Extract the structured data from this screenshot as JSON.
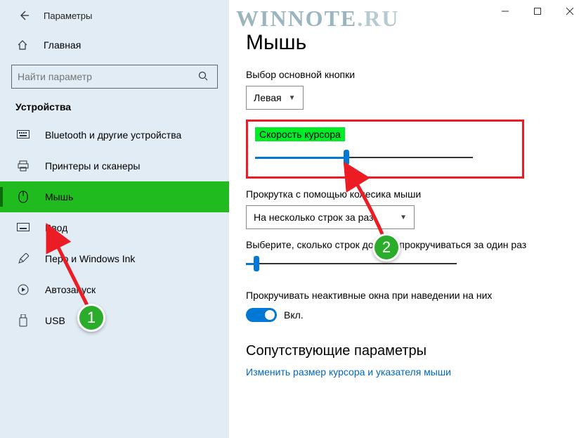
{
  "window": {
    "title": "Параметры"
  },
  "watermark": {
    "main": "WINNOTE",
    "suffix": ".RU"
  },
  "sidebar": {
    "home": "Главная",
    "search_placeholder": "Найти параметр",
    "section": "Устройства",
    "items": [
      {
        "label": "Bluetooth и другие устройства"
      },
      {
        "label": "Принтеры и сканеры"
      },
      {
        "label": "Мышь"
      },
      {
        "label": "Ввод"
      },
      {
        "label": "Перо и Windows Ink"
      },
      {
        "label": "Автозапуск"
      },
      {
        "label": "USB"
      }
    ]
  },
  "main": {
    "title": "Мышь",
    "primary_button": {
      "label": "Выбор основной кнопки",
      "value": "Левая"
    },
    "cursor_speed": {
      "label": "Скорость курсора",
      "value_percent": 42
    },
    "scroll_mode": {
      "label": "Прокрутка с помощью колесика мыши",
      "value": "На несколько строк за раз"
    },
    "lines_at_time": {
      "label": "Выберите, сколько строк должно прокручиваться за один раз",
      "value_percent": 5
    },
    "scroll_inactive": {
      "label": "Прокручивать неактивные окна при наведении на них",
      "state": "Вкл."
    },
    "related": {
      "heading": "Сопутствующие параметры",
      "link": "Изменить размер курсора и указателя мыши"
    }
  },
  "annotations": {
    "badge1": "1",
    "badge2": "2"
  }
}
